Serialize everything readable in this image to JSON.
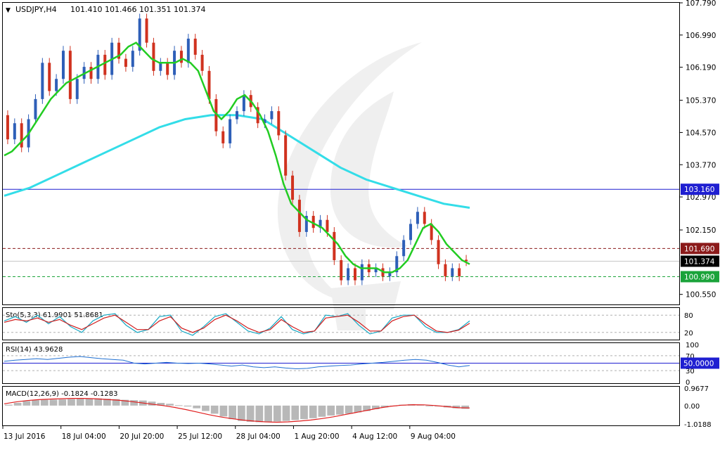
{
  "chart_data": [
    {
      "panel": "price",
      "type": "candlestick",
      "symbol_label": "USDJPY,H4",
      "ohlc_label": "101.410 101.466 101.351 101.374",
      "ylim": [
        100.3,
        107.79
      ],
      "y_ticks": [
        "107.790",
        "106.990",
        "106.190",
        "105.370",
        "104.570",
        "103.770",
        "102.970",
        "102.150",
        "100.550"
      ],
      "x_ticks": [
        "13 Jul 2016",
        "18 Jul 04:00",
        "20 Jul 20:00",
        "25 Jul 12:00",
        "28 Jul 04:00",
        "1 Aug 20:00",
        "4 Aug 12:00",
        "9 Aug 04:00"
      ],
      "levels": [
        {
          "value": 103.16,
          "label": "103.160",
          "color": "#1f1fd1",
          "style": "solid",
          "label_bg": "#1f1fd1"
        },
        {
          "value": 101.69,
          "label": "101.690",
          "color": "#8b1a1a",
          "style": "dashed",
          "label_bg": "#8b1a1a"
        },
        {
          "value": 101.374,
          "label": "101.374",
          "color": "#c8c8c8",
          "style": "solid",
          "label_bg": "#000000"
        },
        {
          "value": 100.99,
          "label": "100.990",
          "color": "#1aa33a",
          "style": "dashed",
          "label_bg": "#1aa33a"
        }
      ],
      "candles": [
        [
          105.0,
          104.4
        ],
        [
          104.4,
          104.8
        ],
        [
          104.8,
          104.2
        ],
        [
          104.2,
          104.9
        ],
        [
          104.9,
          105.4
        ],
        [
          105.4,
          106.3
        ],
        [
          106.3,
          105.6
        ],
        [
          105.6,
          105.9
        ],
        [
          105.9,
          106.6
        ],
        [
          106.6,
          105.4
        ],
        [
          105.4,
          105.9
        ],
        [
          105.9,
          106.2
        ],
        [
          106.2,
          105.9
        ],
        [
          105.9,
          106.5
        ],
        [
          106.5,
          106.0
        ],
        [
          106.0,
          106.8
        ],
        [
          106.8,
          106.4
        ],
        [
          106.4,
          106.2
        ],
        [
          106.2,
          106.6
        ],
        [
          106.6,
          107.4
        ],
        [
          107.4,
          106.8
        ],
        [
          106.8,
          106.1
        ],
        [
          106.1,
          106.3
        ],
        [
          106.3,
          106.0
        ],
        [
          106.0,
          106.6
        ],
        [
          106.6,
          106.3
        ],
        [
          106.3,
          106.9
        ],
        [
          106.9,
          106.5
        ],
        [
          106.5,
          106.1
        ],
        [
          106.1,
          105.4
        ],
        [
          105.4,
          104.6
        ],
        [
          104.6,
          104.3
        ],
        [
          104.3,
          104.9
        ],
        [
          104.9,
          105.1
        ],
        [
          105.1,
          105.5
        ],
        [
          105.5,
          105.2
        ],
        [
          105.2,
          104.8
        ],
        [
          104.8,
          104.9
        ],
        [
          104.9,
          105.1
        ],
        [
          105.1,
          104.5
        ],
        [
          104.5,
          103.5
        ],
        [
          103.5,
          102.9
        ],
        [
          102.9,
          102.1
        ],
        [
          102.1,
          102.5
        ],
        [
          102.5,
          102.2
        ],
        [
          102.2,
          102.4
        ],
        [
          102.4,
          102.1
        ],
        [
          102.1,
          101.4
        ],
        [
          101.4,
          100.9
        ],
        [
          100.9,
          101.2
        ],
        [
          101.2,
          100.9
        ],
        [
          100.9,
          101.3
        ],
        [
          101.3,
          101.1
        ],
        [
          101.1,
          101.2
        ],
        [
          101.2,
          101.0
        ],
        [
          101.0,
          101.1
        ],
        [
          101.1,
          101.5
        ],
        [
          101.5,
          101.9
        ],
        [
          101.9,
          102.3
        ],
        [
          102.3,
          102.6
        ],
        [
          102.6,
          102.3
        ],
        [
          102.3,
          101.9
        ],
        [
          101.9,
          101.3
        ],
        [
          101.3,
          101.0
        ],
        [
          101.0,
          101.2
        ],
        [
          101.2,
          101.0
        ],
        [
          101.41,
          101.374
        ]
      ],
      "ma_fast": [
        104.0,
        104.1,
        104.3,
        104.5,
        104.8,
        105.1,
        105.4,
        105.6,
        105.8,
        105.9,
        106.0,
        106.1,
        106.2,
        106.3,
        106.4,
        106.5,
        106.7,
        106.8,
        106.6,
        106.4,
        106.3,
        106.3,
        106.3,
        106.4,
        106.3,
        106.1,
        105.6,
        105.1,
        104.9,
        105.1,
        105.4,
        105.5,
        105.3,
        105.0,
        104.6,
        104.0,
        103.3,
        102.8,
        102.6,
        102.4,
        102.3,
        102.2,
        102.0,
        101.8,
        101.5,
        101.3,
        101.2,
        101.2,
        101.2,
        101.1,
        101.1,
        101.2,
        101.4,
        101.8,
        102.2,
        102.3,
        102.1,
        101.8,
        101.6,
        101.4,
        101.3
      ],
      "ma_slow": [
        103.0,
        103.2,
        103.5,
        103.8,
        104.1,
        104.4,
        104.7,
        104.9,
        105.0,
        105.0,
        104.9,
        104.5,
        104.1,
        103.7,
        103.4,
        103.2,
        103.0,
        102.8,
        102.7
      ]
    },
    {
      "panel": "stochastic",
      "type": "line",
      "label": "Sto(5,3,3) 61.9901 51.8681",
      "y_ticks": [
        "80",
        "20"
      ],
      "levels": [
        80,
        20
      ],
      "ylim": [
        0,
        100
      ],
      "series": [
        {
          "color": "#17a8c4",
          "values": [
            60,
            75,
            55,
            80,
            50,
            75,
            40,
            20,
            60,
            80,
            85,
            45,
            20,
            30,
            75,
            80,
            25,
            10,
            40,
            75,
            85,
            55,
            25,
            15,
            35,
            75,
            30,
            15,
            25,
            80,
            75,
            85,
            45,
            15,
            25,
            70,
            80,
            80,
            40,
            20,
            20,
            30,
            60
          ]
        },
        {
          "color": "#d01c1c",
          "values": [
            55,
            65,
            60,
            70,
            55,
            65,
            45,
            30,
            50,
            70,
            80,
            55,
            30,
            30,
            60,
            75,
            35,
            20,
            35,
            65,
            80,
            60,
            35,
            20,
            30,
            65,
            40,
            20,
            25,
            70,
            75,
            80,
            55,
            25,
            25,
            60,
            75,
            80,
            50,
            25,
            20,
            28,
            52
          ]
        }
      ]
    },
    {
      "panel": "rsi",
      "type": "line",
      "label": "RSI(14) 43.9628",
      "y_ticks": [
        "100",
        "70",
        "30",
        "0"
      ],
      "levels": [
        70,
        30
      ],
      "ref_label": "50.0000",
      "ylim": [
        0,
        100
      ],
      "series": [
        {
          "color": "#1f6fd1",
          "values": [
            55,
            58,
            60,
            62,
            60,
            63,
            66,
            68,
            65,
            62,
            60,
            58,
            50,
            48,
            50,
            52,
            50,
            49,
            50,
            48,
            45,
            42,
            45,
            40,
            38,
            40,
            37,
            35,
            36,
            40,
            42,
            44,
            45,
            48,
            50,
            52,
            55,
            58,
            60,
            58,
            52,
            45,
            40,
            44
          ]
        }
      ]
    },
    {
      "panel": "macd",
      "type": "bar",
      "label": "MACD(12,26,9) -0.1824 -0.1283",
      "y_ticks": [
        "0.9677",
        "0.00",
        "-1.0188"
      ],
      "ylim": [
        -1.0188,
        0.9677
      ],
      "histogram": [
        0.05,
        0.15,
        0.25,
        0.3,
        0.32,
        0.33,
        0.34,
        0.36,
        0.38,
        0.4,
        0.4,
        0.38,
        0.36,
        0.32,
        0.3,
        0.28,
        0.22,
        0.15,
        0.1,
        0.02,
        -0.05,
        -0.15,
        -0.3,
        -0.45,
        -0.6,
        -0.75,
        -0.85,
        -0.9,
        -0.92,
        -0.9,
        -0.88,
        -0.85,
        -0.8,
        -0.75,
        -0.7,
        -0.62,
        -0.55,
        -0.5,
        -0.45,
        -0.38,
        -0.3,
        -0.2,
        -0.1,
        0.0,
        0.05,
        0.08,
        0.06,
        0.0,
        -0.05,
        -0.1,
        -0.15,
        -0.18
      ],
      "signal": [
        0.1,
        0.2,
        0.28,
        0.33,
        0.36,
        0.38,
        0.4,
        0.4,
        0.38,
        0.34,
        0.3,
        0.24,
        0.16,
        0.08,
        0.0,
        -0.1,
        -0.22,
        -0.36,
        -0.5,
        -0.62,
        -0.72,
        -0.8,
        -0.86,
        -0.9,
        -0.92,
        -0.9,
        -0.86,
        -0.8,
        -0.72,
        -0.62,
        -0.5,
        -0.38,
        -0.26,
        -0.14,
        -0.04,
        0.02,
        0.05,
        0.04,
        0.0,
        -0.06,
        -0.12,
        -0.13
      ]
    }
  ],
  "colors": {
    "bull_candle": "#2e5fb8",
    "bear_candle": "#d0321f",
    "ma_fast": "#22cc22",
    "ma_slow": "#33dde8",
    "macd_hist": "#b8b8b8",
    "macd_signal": "#e01e1e",
    "axis": "#000000",
    "grid_dash": "#b0b0b0"
  }
}
